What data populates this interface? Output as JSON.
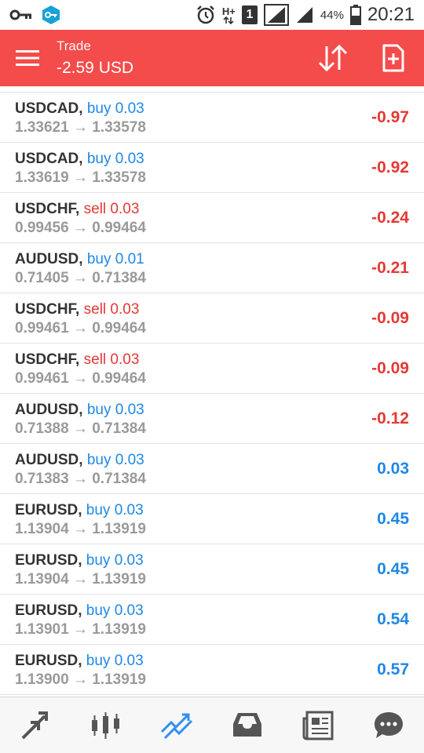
{
  "status_bar": {
    "network_type": "H+",
    "sim_slot": "1",
    "battery_pct": "44%",
    "time": "20:21"
  },
  "app_bar": {
    "title": "Trade",
    "balance": "-2.59 USD",
    "color": "#f44b4b"
  },
  "colors": {
    "buy": "#1e88e5",
    "sell": "#e53935",
    "profit": "#1e88e5",
    "loss": "#e53935"
  },
  "positions": [
    {
      "symbol": "USDCAD,",
      "side": "buy",
      "volume": "0.03",
      "side_text": "buy 0.03",
      "open": "1.33621",
      "current": "1.33578",
      "prices": "1.33621 → 1.33578",
      "pnl": "-0.97"
    },
    {
      "symbol": "USDCAD,",
      "side": "buy",
      "volume": "0.03",
      "side_text": "buy 0.03",
      "open": "1.33619",
      "current": "1.33578",
      "prices": "1.33619 → 1.33578",
      "pnl": "-0.92"
    },
    {
      "symbol": "USDCHF,",
      "side": "sell",
      "volume": "0.03",
      "side_text": "sell 0.03",
      "open": "0.99456",
      "current": "0.99464",
      "prices": "0.99456 → 0.99464",
      "pnl": "-0.24"
    },
    {
      "symbol": "AUDUSD,",
      "side": "buy",
      "volume": "0.01",
      "side_text": "buy 0.01",
      "open": "0.71405",
      "current": "0.71384",
      "prices": "0.71405 → 0.71384",
      "pnl": "-0.21"
    },
    {
      "symbol": "USDCHF,",
      "side": "sell",
      "volume": "0.03",
      "side_text": "sell 0.03",
      "open": "0.99461",
      "current": "0.99464",
      "prices": "0.99461 → 0.99464",
      "pnl": "-0.09"
    },
    {
      "symbol": "USDCHF,",
      "side": "sell",
      "volume": "0.03",
      "side_text": "sell 0.03",
      "open": "0.99461",
      "current": "0.99464",
      "prices": "0.99461 → 0.99464",
      "pnl": "-0.09"
    },
    {
      "symbol": "AUDUSD,",
      "side": "buy",
      "volume": "0.03",
      "side_text": "buy 0.03",
      "open": "0.71388",
      "current": "0.71384",
      "prices": "0.71388 → 0.71384",
      "pnl": "-0.12"
    },
    {
      "symbol": "AUDUSD,",
      "side": "buy",
      "volume": "0.03",
      "side_text": "buy 0.03",
      "open": "0.71383",
      "current": "0.71384",
      "prices": "0.71383 → 0.71384",
      "pnl": "0.03"
    },
    {
      "symbol": "EURUSD,",
      "side": "buy",
      "volume": "0.03",
      "side_text": "buy 0.03",
      "open": "1.13904",
      "current": "1.13919",
      "prices": "1.13904 → 1.13919",
      "pnl": "0.45"
    },
    {
      "symbol": "EURUSD,",
      "side": "buy",
      "volume": "0.03",
      "side_text": "buy 0.03",
      "open": "1.13904",
      "current": "1.13919",
      "prices": "1.13904 → 1.13919",
      "pnl": "0.45"
    },
    {
      "symbol": "EURUSD,",
      "side": "buy",
      "volume": "0.03",
      "side_text": "buy 0.03",
      "open": "1.13901",
      "current": "1.13919",
      "prices": "1.13901 → 1.13919",
      "pnl": "0.54"
    },
    {
      "symbol": "EURUSD,",
      "side": "buy",
      "volume": "0.03",
      "side_text": "buy 0.03",
      "open": "1.13900",
      "current": "1.13919",
      "prices": "1.13900 → 1.13919",
      "pnl": "0.57"
    }
  ],
  "bottom_nav": [
    {
      "icon": "quotes-arrows-icon"
    },
    {
      "icon": "candlestick-chart-icon"
    },
    {
      "icon": "trade-trend-icon",
      "active": true
    },
    {
      "icon": "history-inbox-icon"
    },
    {
      "icon": "news-icon"
    },
    {
      "icon": "chat-bubble-icon"
    }
  ]
}
